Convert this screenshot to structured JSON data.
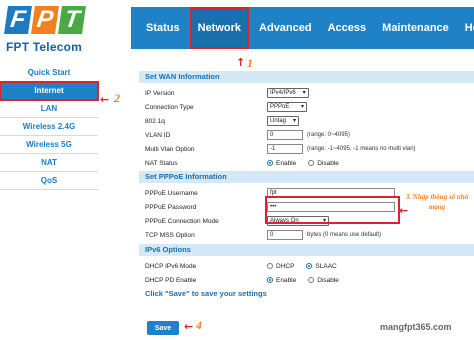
{
  "brand": {
    "letters": [
      "F",
      "P",
      "T"
    ],
    "name": "FPT Telecom"
  },
  "topnav": {
    "items": [
      {
        "label": "Status"
      },
      {
        "label": "Network",
        "active": true
      },
      {
        "label": "Advanced"
      },
      {
        "label": "Access"
      },
      {
        "label": "Maintenance"
      },
      {
        "label": "Help"
      }
    ]
  },
  "sidebar": {
    "items": [
      {
        "label": "Quick Start"
      },
      {
        "label": "Internet",
        "active": true
      },
      {
        "label": "LAN"
      },
      {
        "label": "Wireless 2.4G"
      },
      {
        "label": "Wireless 5G"
      },
      {
        "label": "NAT"
      },
      {
        "label": "QoS"
      }
    ]
  },
  "wan": {
    "title": "Set WAN Information",
    "ip_version_label": "IP Version",
    "ip_version_value": "IPv4/IPv6",
    "connection_type_label": "Connection Type",
    "connection_type_value": "PPPoE",
    "dot1q_label": "802.1q",
    "dot1q_value": "Untag",
    "vlan_id_label": "VLAN ID",
    "vlan_id_value": "0",
    "vlan_id_hint": "(range: 0~4095)",
    "multi_vlan_label": "Multi Vlan Option",
    "multi_vlan_value": "-1",
    "multi_vlan_hint": "(range: -1~4095, -1 means no multi vlan)",
    "nat_status_label": "NAT Status",
    "nat_enable": "Enable",
    "nat_disable": "Disable"
  },
  "pppoe": {
    "title": "Set PPPoE Information",
    "username_label": "PPPoE Username",
    "username_value": "fpt",
    "password_label": "PPPoE Password",
    "password_value": "•••",
    "connection_mode_label": "PPPoE Connection Mode",
    "connection_mode_value": "Always On",
    "mss_label": "TCP MSS Option",
    "mss_value": "0",
    "mss_hint": "bytes  (0 means use default)"
  },
  "ipv6": {
    "title": "IPv6 Options",
    "dhcp_mode_label": "DHCP IPv6 Mode",
    "dhcp_option": "DHCP",
    "slaac_option": "SLAAC",
    "pd_label": "DHCP PD Enable",
    "pd_enable": "Enable",
    "pd_disable": "Disable"
  },
  "footer": {
    "note": "Click \"Save\" to save your settings",
    "save_label": "Save"
  },
  "annotations": {
    "a1": "1",
    "a2": "2",
    "a3": "3. Nhập thông số nhà mạng",
    "a4": "4"
  },
  "watermark": "mangfpt365.com",
  "colors": {
    "nav_blue": "#1f82c6",
    "highlight_red": "#d9232d",
    "annotation_orange": "#f2801f"
  }
}
